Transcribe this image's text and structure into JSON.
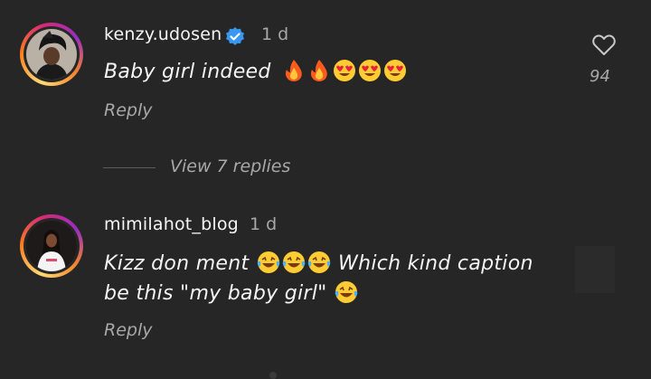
{
  "comments": [
    {
      "username": "kenzy.udosen",
      "verified": true,
      "time": "1 d",
      "text": "Baby girl indeed",
      "emojis": [
        "fire-emoji",
        "fire-emoji",
        "heart-eyes-emoji",
        "heart-eyes-emoji",
        "heart-eyes-emoji"
      ],
      "reply_label": "Reply",
      "like_count": "94",
      "view_replies_label": "View 7 replies"
    },
    {
      "username": "mimilahot_blog",
      "verified": false,
      "time": "1 d",
      "text_line1_a": "Kizz don ment",
      "text_line1_b": "Which kind caption",
      "text_line2": "be this \"my baby girl\"",
      "emojis_line1": [
        "laughing-tears-emoji",
        "laughing-tears-emoji",
        "laughing-tears-emoji"
      ],
      "emojis_line2": [
        "laughing-tears-emoji"
      ],
      "reply_label": "Reply"
    }
  ],
  "colors": {
    "background": "#262626",
    "text_primary": "#f5f5f5",
    "text_secondary": "#a8a8a8",
    "verified_blue": "#3897f0"
  }
}
